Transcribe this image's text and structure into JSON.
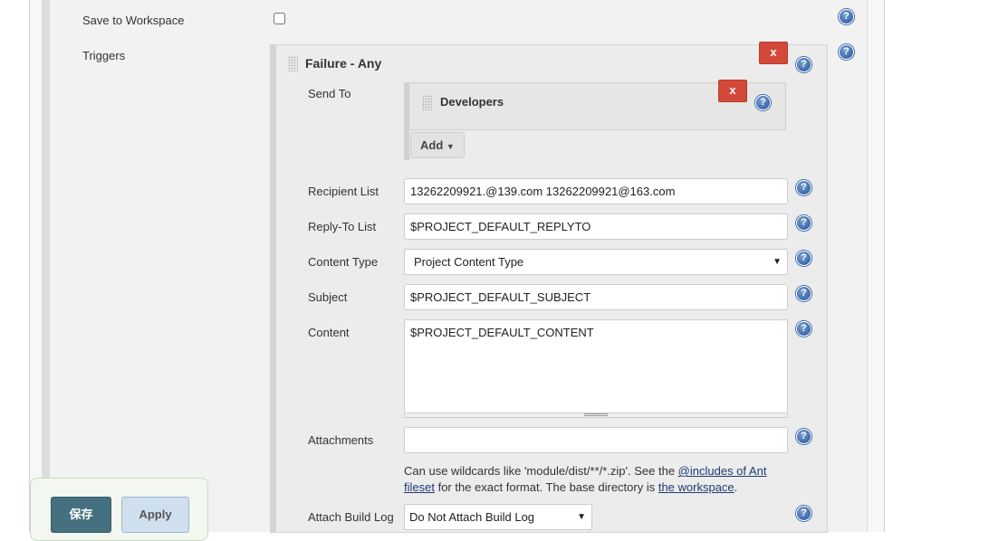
{
  "save_to_workspace": {
    "label": "Save to Workspace",
    "checked": false
  },
  "triggers": {
    "label": "Triggers",
    "trigger": {
      "title": "Failure - Any",
      "delete_label": "x",
      "send_to": {
        "label": "Send To",
        "item": "Developers",
        "delete_label": "x",
        "add_label": "Add"
      },
      "recipient_list": {
        "label": "Recipient List",
        "value": "13262209921.@139.com 13262209921@163.com"
      },
      "reply_to": {
        "label": "Reply-To List",
        "value": "$PROJECT_DEFAULT_REPLYTO"
      },
      "content_type": {
        "label": "Content Type",
        "value": "Project Content Type"
      },
      "subject": {
        "label": "Subject",
        "value": "$PROJECT_DEFAULT_SUBJECT"
      },
      "content": {
        "label": "Content",
        "value": "$PROJECT_DEFAULT_CONTENT"
      },
      "attachments": {
        "label": "Attachments",
        "value": "",
        "help_pre": "Can use wildcards like 'module/dist/**/*.zip'. See the ",
        "help_link1": "@includes of Ant fileset",
        "help_mid": " for the exact format. The base directory is ",
        "help_link2": "the workspace",
        "help_post": "."
      },
      "attach_build_log": {
        "label": "Attach Build Log",
        "value": "Do Not Attach Build Log"
      }
    }
  },
  "help_icon": "?",
  "buttons": {
    "save": "保存",
    "apply": "Apply"
  },
  "colors": {
    "delete": "#d24939",
    "save": "#45707f",
    "apply": "#cfdfee",
    "help": "#1f4f96"
  }
}
